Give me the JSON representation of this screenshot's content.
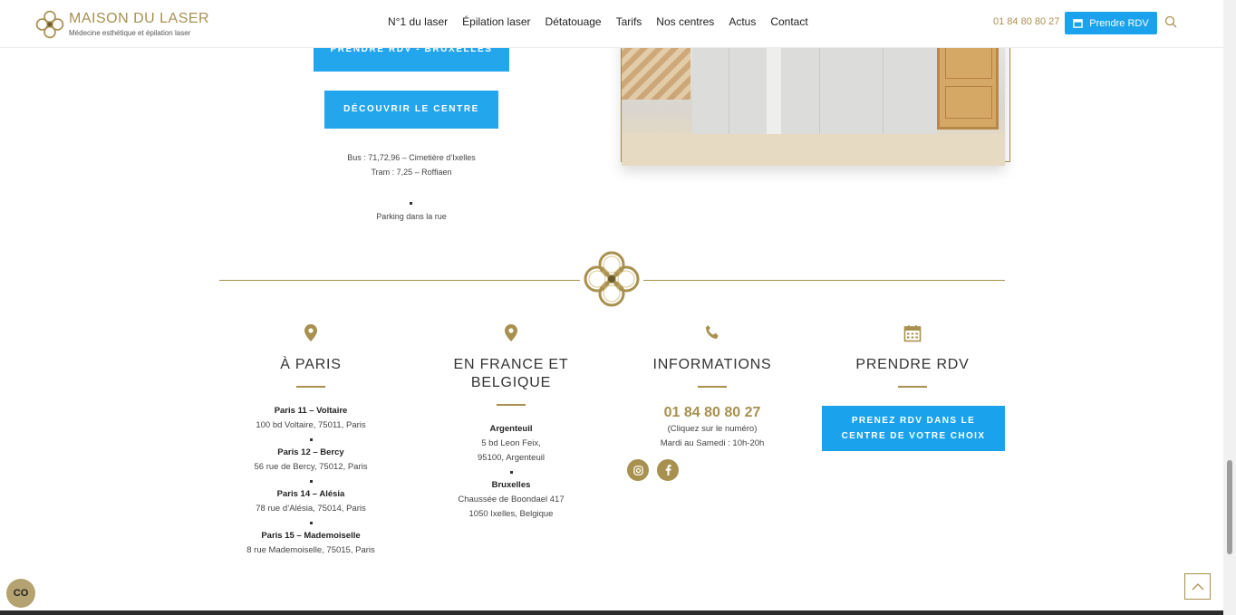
{
  "brand": {
    "title": "MAISON DU LASER",
    "subtitle": "Médecine esthétique et épilation laser"
  },
  "nav": [
    "N°1 du laser",
    "Épilation laser",
    "Détatouage",
    "Tarifs",
    "Nos centres",
    "Actus",
    "Contact"
  ],
  "header": {
    "phone": "01 84 80 80 27",
    "rdv_label": "Prendre RDV"
  },
  "centre": {
    "btn_rdv": "PRENDRE RDV - BRUXELLES",
    "btn_discover": "DÉCOUVRIR LE CENTRE",
    "bus": "Bus : 71,72,96 – Cimetière d’Ixelles",
    "tram": "Tram : 7,25 – Roffiaen",
    "parking": "Parking dans la rue"
  },
  "footer": {
    "paris": {
      "title": "À PARIS",
      "centres": [
        {
          "name": "Paris 11 – Voltaire",
          "address": "100 bd Voltaire, 75011, Paris"
        },
        {
          "name": "Paris 12 – Bercy",
          "address": "56 rue de Bercy, 75012, Paris"
        },
        {
          "name": "Paris 14 – Alésia",
          "address": "78 rue d’Alésia, 75014, Paris"
        },
        {
          "name": "Paris 15 – Mademoiselle",
          "address": "8 rue Mademoiselle, 75015, Paris"
        }
      ]
    },
    "france": {
      "title": "EN FRANCE ET BELGIQUE",
      "centres": [
        {
          "name": "Argenteuil",
          "line1": "5 bd Leon Feix,",
          "line2": "95100, Argenteuil"
        },
        {
          "name": "Bruxelles",
          "line1": "Chaussée de Boondael 417",
          "line2": "1050 Ixelles, Belgique"
        }
      ]
    },
    "info": {
      "title": "INFORMATIONS",
      "phone": "01 84 80 80 27",
      "click_note": "(Cliquez sur le numéro)",
      "hours": "Mardi au Samedi : 10h-20h"
    },
    "rdv": {
      "title": "PRENDRE RDV",
      "button": "PRENEZ RDV DANS LE CENTRE DE VOTRE CHOIX"
    }
  },
  "cookie_label": "CO",
  "icons": [
    "calendar-icon",
    "search-icon",
    "map-pin-icon",
    "phone-icon",
    "instagram-icon",
    "facebook-icon",
    "chevron-up-icon"
  ],
  "colors": {
    "gold": "#a8904f",
    "blue": "#1aa3ec"
  }
}
